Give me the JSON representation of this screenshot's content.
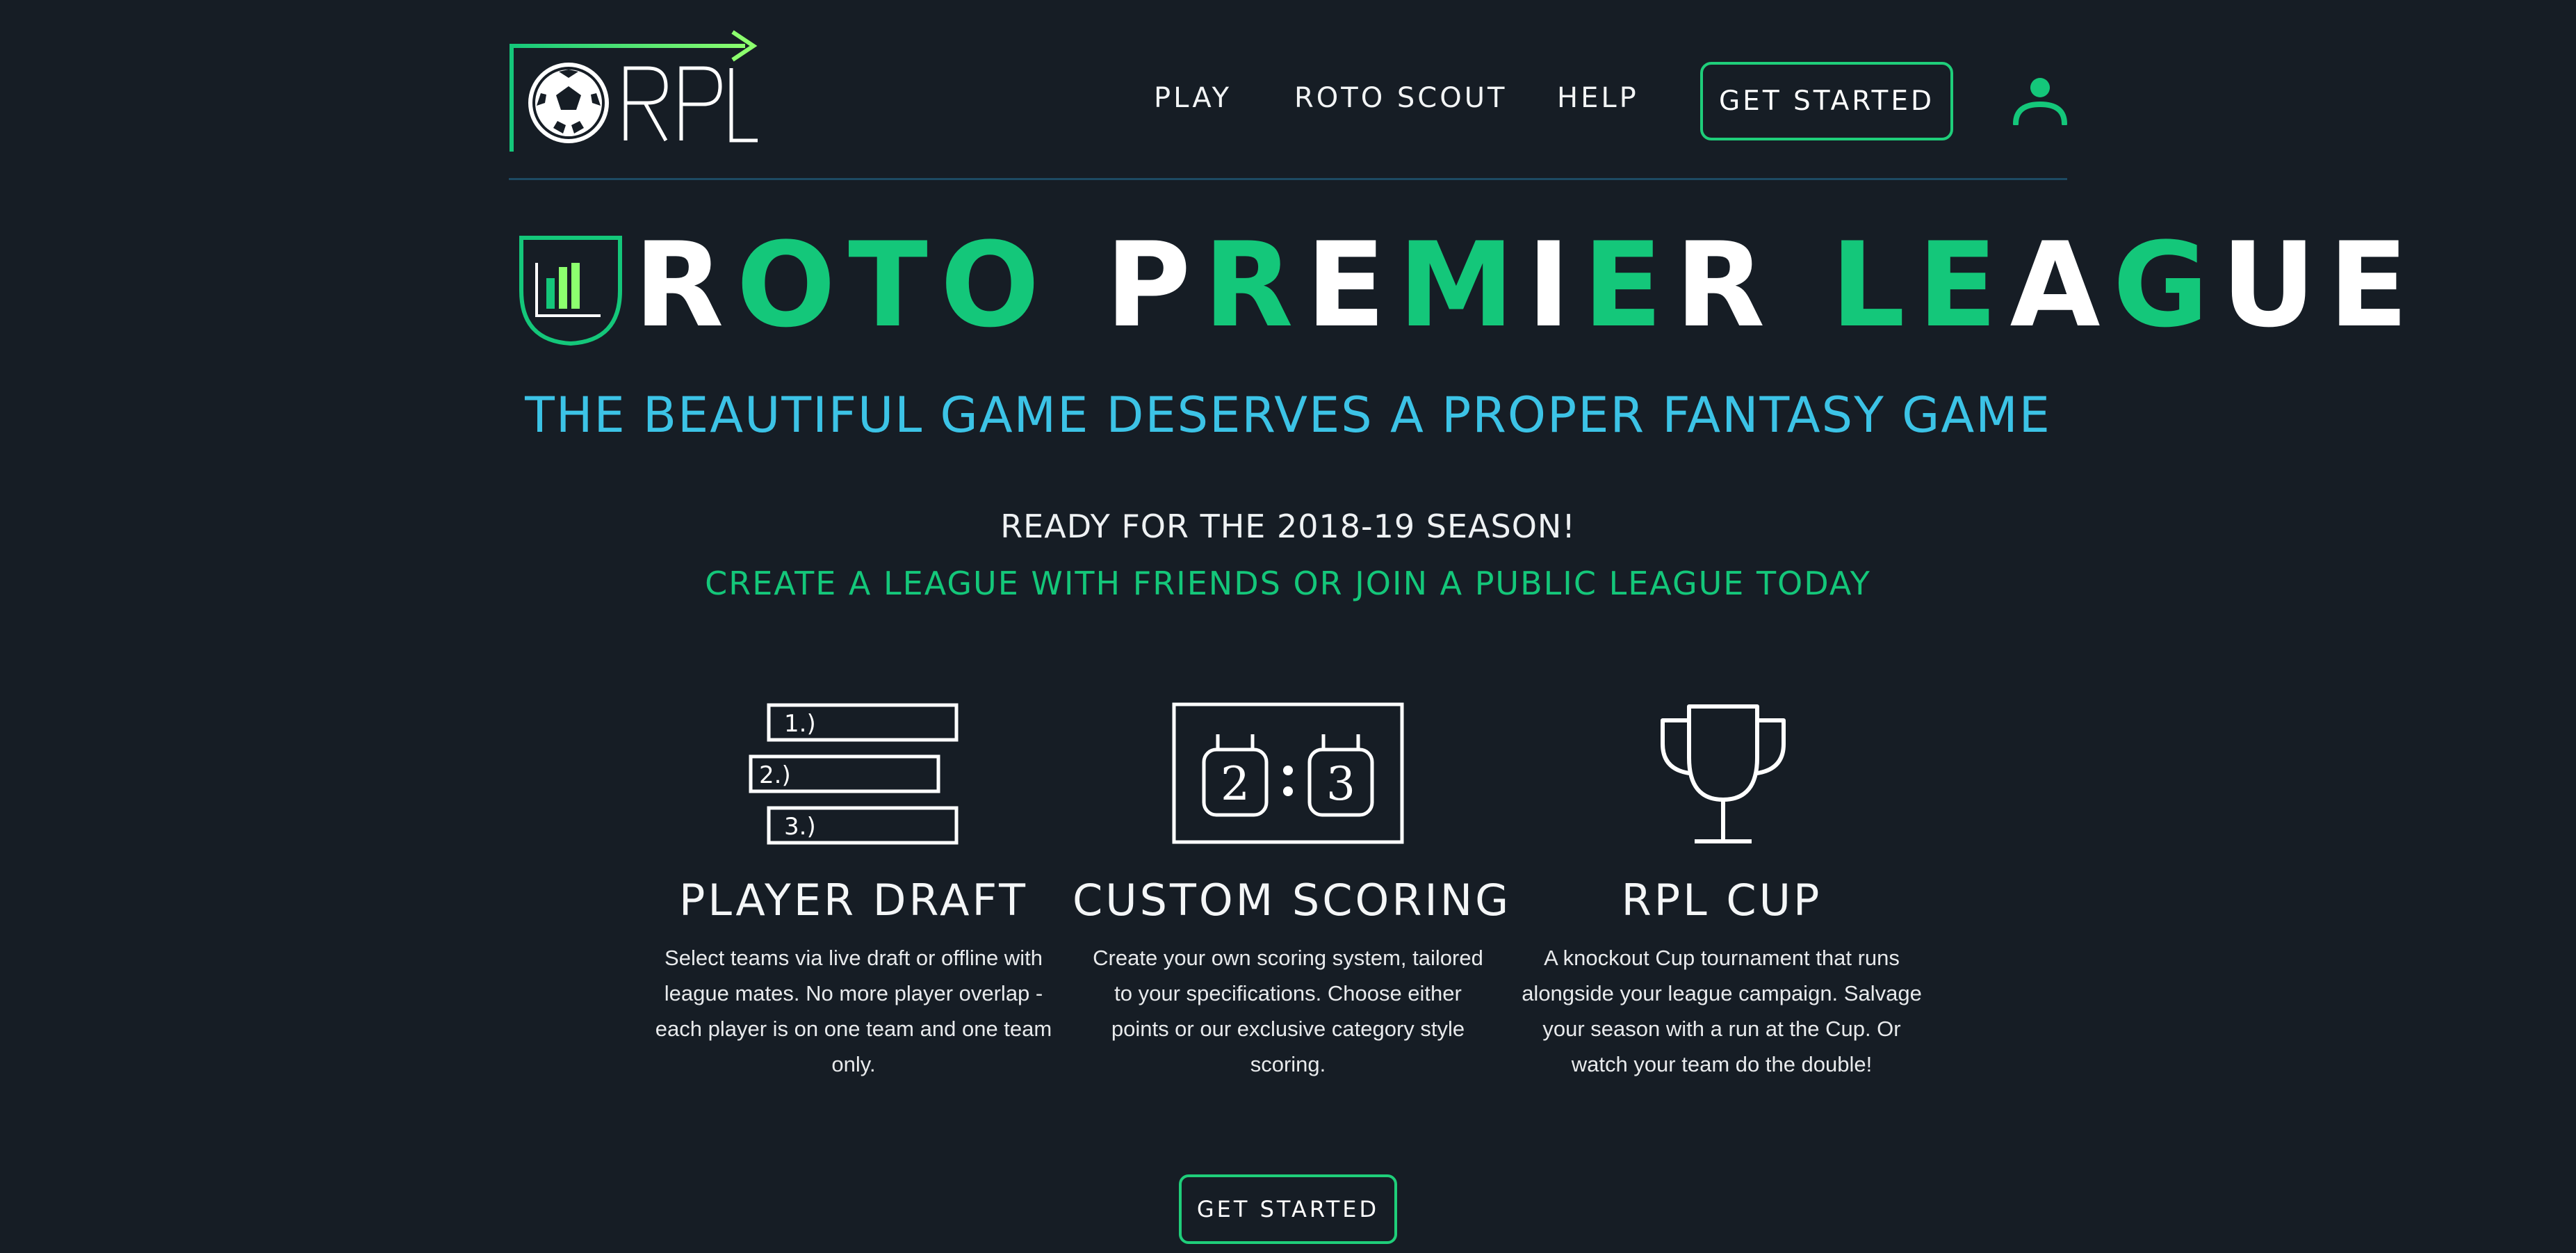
{
  "logo": {
    "text": "RPL"
  },
  "nav": {
    "items": [
      {
        "label": "PLAY"
      },
      {
        "label": "ROTO SCOUT"
      },
      {
        "label": "HELP"
      }
    ],
    "cta_label": "GET STARTED"
  },
  "hero": {
    "title_words": [
      [
        {
          "t": "R",
          "c": "w"
        },
        {
          "t": "OTO",
          "c": "g"
        }
      ],
      [
        {
          "t": "P",
          "c": "w"
        },
        {
          "t": "R",
          "c": "g"
        },
        {
          "t": "E",
          "c": "w"
        },
        {
          "t": "M",
          "c": "g"
        },
        {
          "t": "I",
          "c": "w"
        },
        {
          "t": "E",
          "c": "g"
        },
        {
          "t": "R",
          "c": "w"
        }
      ],
      [
        {
          "t": "LE",
          "c": "g"
        },
        {
          "t": "A",
          "c": "w"
        },
        {
          "t": "G",
          "c": "g"
        },
        {
          "t": "UE",
          "c": "w"
        }
      ]
    ],
    "title": "ROTO PREMIER LEAGUE",
    "subtitle": "THE BEAUTIFUL GAME DESERVES A PROPER FANTASY GAME",
    "season_text": "READY FOR THE 2018-19 SEASON!",
    "league_text": "CREATE A LEAGUE WITH FRIENDS OR JOIN A PUBLIC LEAGUE TODAY"
  },
  "features": {
    "draft": {
      "icon_labels": [
        "1.)",
        "2.)",
        "3.)"
      ],
      "title": "PLAYER DRAFT",
      "description": "Select teams via live draft or offline with league mates. No more player overlap - each player is on one team and one team only."
    },
    "scoring": {
      "score_home": "2",
      "score_away": "3",
      "title": "CUSTOM SCORING",
      "description": "Create your own scoring system, tailored to your specifications. Choose either points or our exclusive category style scoring."
    },
    "cup": {
      "title": "RPL CUP",
      "description": "A knockout Cup tournament that runs alongside your league campaign. Salvage your season with a run at the Cup. Or watch your team do the double!"
    }
  },
  "bottom_cta": {
    "label": "GET STARTED"
  },
  "colors": {
    "background": "#161d25",
    "accent_green": "#14c77a",
    "accent_blue": "#3cc3e6",
    "divider": "#1d4a63"
  }
}
